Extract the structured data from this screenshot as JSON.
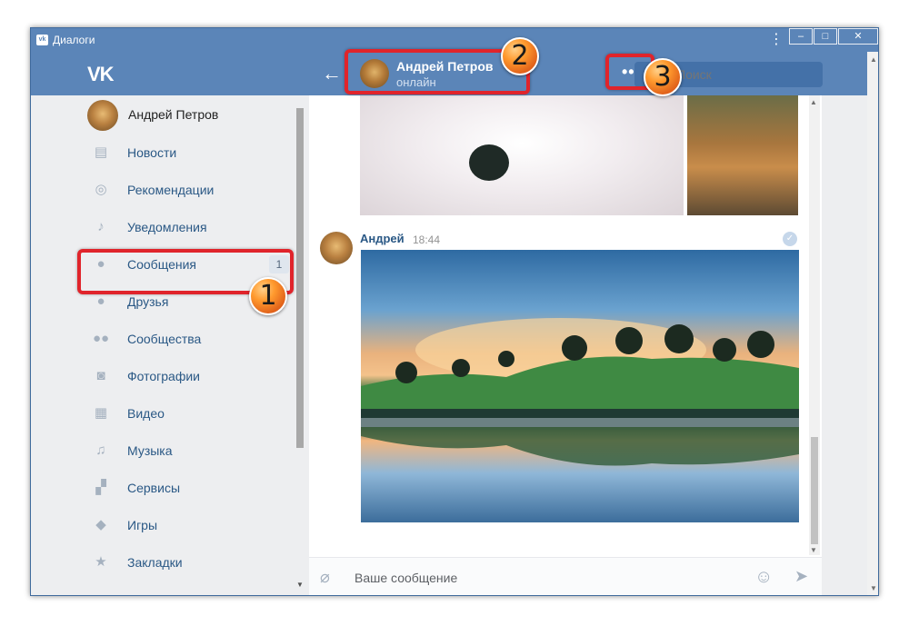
{
  "window": {
    "title": "Диалоги",
    "app_icon": "vk-icon"
  },
  "header": {
    "logo": "VK",
    "contact_name": "Андрей Петров",
    "contact_status": "онлайн",
    "search_placeholder": "Поиск"
  },
  "sidebar": {
    "profile_name": "Андрей Петров",
    "items": [
      {
        "label": "Новости",
        "icon": "news-icon"
      },
      {
        "label": "Рекомендации",
        "icon": "compass-icon"
      },
      {
        "label": "Уведомления",
        "icon": "bell-icon"
      },
      {
        "label": "Сообщения",
        "icon": "messages-icon",
        "badge": "1"
      },
      {
        "label": "Друзья",
        "icon": "friends-icon"
      },
      {
        "label": "Сообщества",
        "icon": "communities-icon"
      },
      {
        "label": "Фотографии",
        "icon": "camera-icon"
      },
      {
        "label": "Видео",
        "icon": "video-icon"
      },
      {
        "label": "Музыка",
        "icon": "music-icon"
      },
      {
        "label": "Сервисы",
        "icon": "services-icon"
      },
      {
        "label": "Игры",
        "icon": "games-icon"
      },
      {
        "label": "Закладки",
        "icon": "bookmark-icon"
      }
    ]
  },
  "chat": {
    "message_author": "Андрей",
    "message_time": "18:44",
    "composer_placeholder": "Ваше сообщение"
  },
  "annotations": {
    "marker1": "1",
    "marker2": "2",
    "marker3": "3",
    "color": "#e0242b"
  }
}
